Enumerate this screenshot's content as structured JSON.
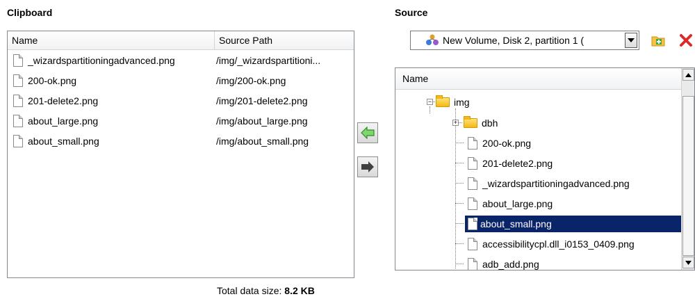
{
  "clipboard": {
    "title": "Clipboard",
    "columns": {
      "name": "Name",
      "source_path": "Source Path"
    },
    "rows": [
      {
        "name": "_wizardspartitioningadvanced.png",
        "path": "/img/_wizardspartitioni..."
      },
      {
        "name": "200-ok.png",
        "path": "/img/200-ok.png"
      },
      {
        "name": "201-delete2.png",
        "path": "/img/201-delete2.png"
      },
      {
        "name": "about_large.png",
        "path": "/img/about_large.png"
      },
      {
        "name": "about_small.png",
        "path": "/img/about_small.png"
      }
    ]
  },
  "total": {
    "label": "Total data size:",
    "value": "8.2 KB"
  },
  "source": {
    "title": "Source",
    "volume": "New Volume, Disk 2, partition 1 (",
    "tree_header": "Name",
    "tree": [
      {
        "label": "img",
        "type": "folder"
      },
      {
        "label": "dbh",
        "type": "folder"
      },
      {
        "label": "200-ok.png",
        "type": "file"
      },
      {
        "label": "201-delete2.png",
        "type": "file"
      },
      {
        "label": "_wizardspartitioningadvanced.png",
        "type": "file"
      },
      {
        "label": "about_large.png",
        "type": "file"
      },
      {
        "label": "about_small.png",
        "type": "file",
        "selected": true
      },
      {
        "label": "accessibilitycpl.dll_i0153_0409.png",
        "type": "file"
      },
      {
        "label": "adb_add.png",
        "type": "file"
      }
    ]
  },
  "colors": {
    "selection": "#0a246a",
    "arrow_green": "#3fa93a",
    "arrow_dark": "#404040",
    "delete_red": "#d92b2b"
  }
}
